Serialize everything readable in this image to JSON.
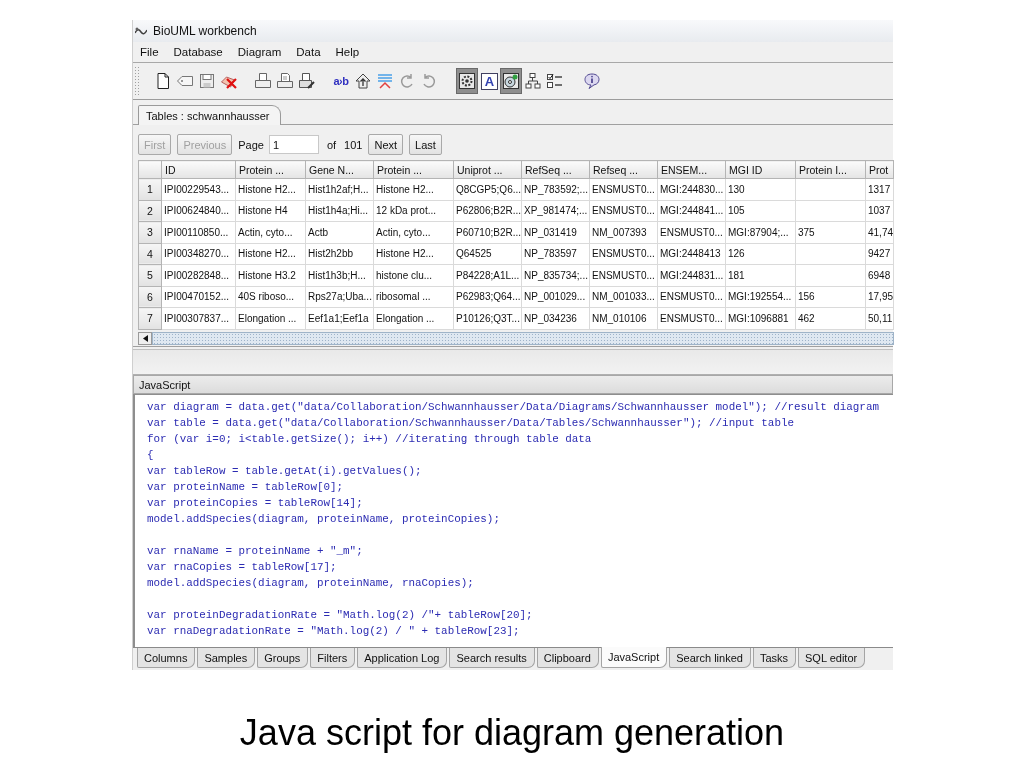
{
  "window": {
    "title": "BioUML workbench"
  },
  "menu": [
    "File",
    "Database",
    "Diagram",
    "Data",
    "Help"
  ],
  "toolbar": {
    "groups": [
      {
        "buttons": [
          {
            "kind": "icon",
            "pressed": false
          },
          {
            "kind": "icon",
            "pressed": false
          },
          {
            "kind": "icon",
            "pressed": false
          },
          {
            "kind": "icon",
            "pressed": false
          }
        ]
      },
      {
        "buttons": [
          {
            "kind": "icon",
            "pressed": false
          },
          {
            "kind": "icon",
            "pressed": false
          },
          {
            "kind": "icon",
            "pressed": false
          }
        ]
      },
      {
        "buttons": [
          {
            "kind": "glyph",
            "glyph": "a›b",
            "pressed": false
          },
          {
            "kind": "icon",
            "pressed": false
          },
          {
            "kind": "icon",
            "pressed": false
          },
          {
            "kind": "icon",
            "pressed": false
          },
          {
            "kind": "icon",
            "pressed": false
          }
        ]
      },
      {
        "buttons": [
          {
            "kind": "icon",
            "pressed": true
          },
          {
            "kind": "boxed_glyph",
            "glyph": "A",
            "pressed": false
          },
          {
            "kind": "icon",
            "pressed": true
          },
          {
            "kind": "icon",
            "pressed": false
          },
          {
            "kind": "icon",
            "pressed": false
          }
        ]
      },
      {
        "buttons": [
          {
            "kind": "icon",
            "pressed": false
          }
        ]
      }
    ]
  },
  "document_tabs": [
    {
      "label": "Tables : schwannhausser",
      "selected": true
    }
  ],
  "pager": {
    "back": [
      {
        "label": "First",
        "disabled": true
      },
      {
        "label": "Previous",
        "disabled": true
      }
    ],
    "page_label": "Page",
    "page_value": "1",
    "of_label": "of",
    "page_count": "101",
    "forward": [
      {
        "label": "Next",
        "disabled": false
      },
      {
        "label": "Last",
        "disabled": false
      }
    ]
  },
  "table": {
    "columns": [
      "ID",
      "Protein ...",
      "Gene N...",
      "Protein ...",
      "Uniprot ...",
      "RefSeq ...",
      "Refseq ...",
      "ENSEM...",
      "MGI ID",
      "Protein I...",
      "Prot"
    ],
    "rows": [
      {
        "number": "1",
        "cells": [
          "IPI00229543...",
          "Histone H2...",
          "Hist1h2af;H...",
          "Histone H2...",
          "Q8CGP5;Q6...",
          "NP_783592;...",
          "ENSMUST0...",
          "MGI:244830...",
          "130",
          null,
          "1317"
        ]
      },
      {
        "number": "2",
        "cells": [
          "IPI00624840...",
          "Histone H4",
          "Hist1h4a;Hi...",
          "12 kDa prot...",
          "P62806;B2R...",
          "XP_981474;...",
          "ENSMUST0...",
          "MGI:244841...",
          "105",
          null,
          "1037"
        ]
      },
      {
        "number": "3",
        "cells": [
          "IPI00110850...",
          "Actin, cyto...",
          "Actb",
          "Actin, cyto...",
          "P60710;B2R...",
          "NP_031419",
          "NM_007393",
          "ENSMUST0...",
          "MGI:87904;...",
          "375",
          "41,74"
        ]
      },
      {
        "number": "4",
        "cells": [
          "IPI00348270...",
          "Histone H2...",
          "Hist2h2bb",
          "Histone H2...",
          "Q64525",
          "NP_783597",
          "ENSMUST0...",
          "MGI:2448413",
          "126",
          null,
          "9427"
        ]
      },
      {
        "number": "5",
        "cells": [
          "IPI00282848...",
          "Histone H3.2",
          "Hist1h3b;H...",
          "histone clu...",
          "P84228;A1L...",
          "NP_835734;...",
          "ENSMUST0...",
          "MGI:244831...",
          "181",
          null,
          "6948"
        ]
      },
      {
        "number": "6",
        "cells": [
          "IPI00470152...",
          "40S riboso...",
          "Rps27a;Uba...",
          "ribosomal ...",
          "P62983;Q64...",
          "NP_001029...",
          "NM_001033...",
          "ENSMUST0...",
          "MGI:192554...",
          "156",
          "17,95"
        ]
      },
      {
        "number": "7",
        "cells": [
          "IPI00307837...",
          "Elongation ...",
          "Eef1a1;Eef1a",
          "Elongation ...",
          "P10126;Q3T...",
          "NP_034236",
          "NM_010106",
          "ENSMUST0...",
          "MGI:1096881",
          "462",
          "50,11"
        ]
      }
    ]
  },
  "script_panel": {
    "title": "JavaScript",
    "blocks": [
      {
        "lines": [
          "var diagram = data.get(\"data/Collaboration/Schwannhausser/Data/Diagrams/Schwannhausser model\"); //result diagram",
          "var table = data.get(\"data/Collaboration/Schwannhausser/Data/Tables/Schwannhausser\"); //input table",
          "for (var i=0; i<table.getSize(); i++) //iterating through table data",
          "{",
          "var tableRow = table.getAt(i).getValues();",
          "var proteinName = tableRow[0];",
          "var proteinCopies = tableRow[14];",
          "model.addSpecies(diagram, proteinName, proteinCopies);"
        ]
      },
      {
        "lines": [
          "var rnaName = proteinName + \"_m\";",
          "var rnaCopies = tableRow[17];",
          "model.addSpecies(diagram, proteinName, rnaCopies);"
        ]
      },
      {
        "lines": [
          "var proteinDegradationRate = \"Math.log(2) /\"+ tableRow[20];",
          "var rnaDegradationRate = \"Math.log(2) / \" + tableRow[23];"
        ]
      }
    ]
  },
  "bottom_tabs": [
    {
      "label": "Columns",
      "selected": false
    },
    {
      "label": "Samples",
      "selected": false
    },
    {
      "label": "Groups",
      "selected": false
    },
    {
      "label": "Filters",
      "selected": false
    },
    {
      "label": "Application Log",
      "selected": false
    },
    {
      "label": "Search results",
      "selected": false
    },
    {
      "label": "Clipboard",
      "selected": false
    },
    {
      "label": "JavaScript",
      "selected": true
    },
    {
      "label": "Search linked",
      "selected": false
    },
    {
      "label": "Tasks",
      "selected": false
    },
    {
      "label": "SQL editor",
      "selected": false
    }
  ],
  "caption": "Java script for diagram generation"
}
